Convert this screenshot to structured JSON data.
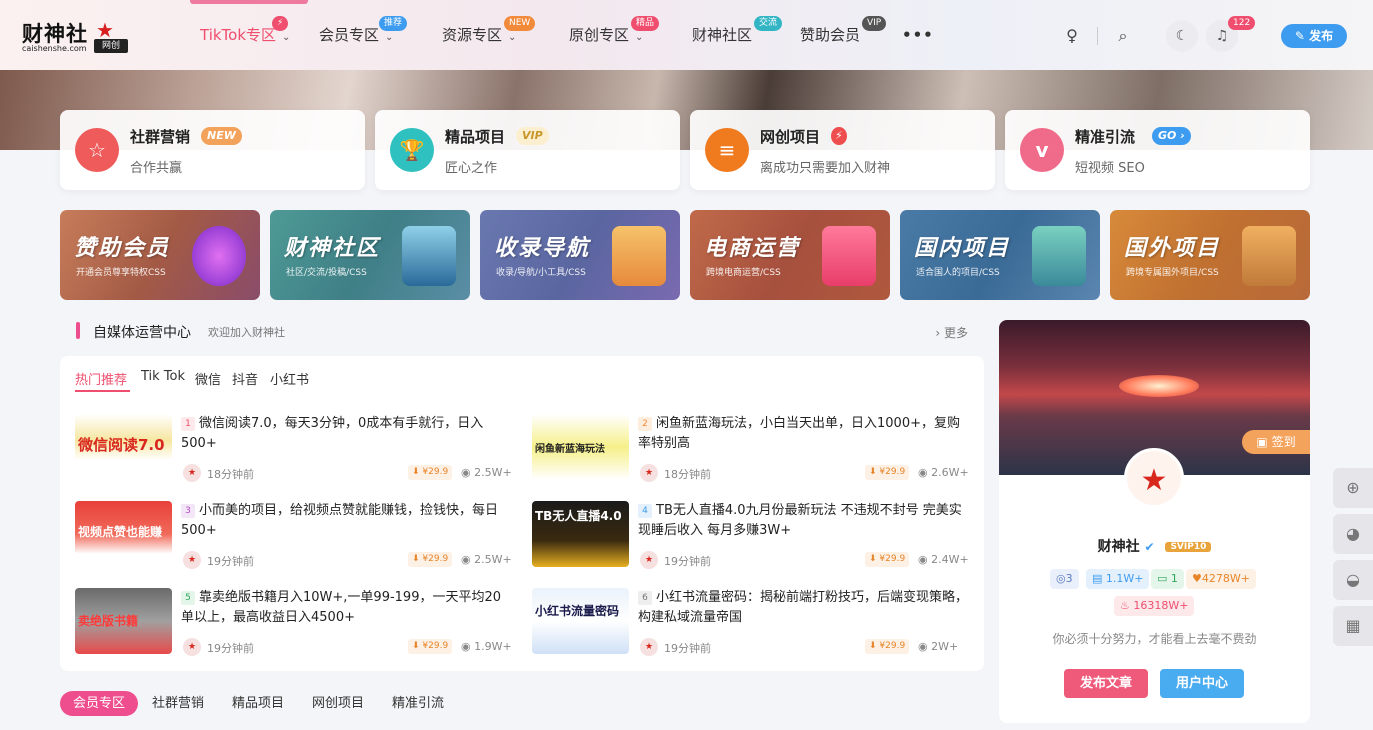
{
  "brand": {
    "name": "财神社",
    "domain": "caishenshe.com",
    "tag": "网创"
  },
  "nav": {
    "items": [
      {
        "label": "TikTok专区",
        "badge": "⚡",
        "badge_color": "#ef4e6e"
      },
      {
        "label": "会员专区",
        "badge": "推荐",
        "badge_color": "#3e9cf0"
      },
      {
        "label": "资源专区",
        "badge": "NEW",
        "badge_color": "#f28a3c"
      },
      {
        "label": "原创专区",
        "badge": "精品",
        "badge_color": "#ef4e6e"
      },
      {
        "label": "财神社区",
        "badge": "交流",
        "badge_color": "#34b5c4"
      },
      {
        "label": "赞助会员",
        "badge": "VIP",
        "badge_color": "#555"
      }
    ],
    "more": "•••",
    "notif_count": "122",
    "publish": "✎ 发布"
  },
  "cards": [
    {
      "title": "社群营销",
      "badge": "NEW",
      "desc": "合作共赢",
      "icon": "☆",
      "color": "#ef5a5a"
    },
    {
      "title": "精品项目",
      "badge": "VIP",
      "desc": "匠心之作",
      "icon": "🏆",
      "color": "#2fc0c0"
    },
    {
      "title": "网创项目",
      "badge": "⚡",
      "desc": "离成功只需要加入财神",
      "icon": "≡",
      "color": "#f07a1e"
    },
    {
      "title": "精准引流",
      "badge": "GO ›",
      "desc": "短视频 SEO",
      "icon": "v",
      "color": "#f06a8a"
    }
  ],
  "banners": [
    {
      "title": "赞助会员",
      "sub": "开通会员尊享特权CSS"
    },
    {
      "title": "财神社区",
      "sub": "社区/交流/投稿/CSS"
    },
    {
      "title": "收录导航",
      "sub": "收录/导航/小工具/CSS"
    },
    {
      "title": "电商运营",
      "sub": "跨境电商运营/CSS"
    },
    {
      "title": "国内项目",
      "sub": "适合国人的项目/CSS"
    },
    {
      "title": "国外项目",
      "sub": "跨境专属国外项目/CSS"
    }
  ],
  "section": {
    "title": "自媒体运营中心",
    "subtitle": "欢迎加入财神社",
    "more": "› 更多"
  },
  "tabs": [
    "热门推荐",
    "Tik Tok",
    "微信",
    "抖音",
    "小红书"
  ],
  "posts": [
    {
      "num": "1",
      "title": "微信阅读7.0，每天3分钟，0成本有手就行，日入500+",
      "time": "18分钟前",
      "price": "¥29.9",
      "views": "2.5W+",
      "thumb": "微信阅读7.0"
    },
    {
      "num": "2",
      "title": "闲鱼新蓝海玩法，小白当天出单，日入1000+，复购率特别高",
      "time": "18分钟前",
      "price": "¥29.9",
      "views": "2.6W+",
      "thumb": "闲鱼新蓝海玩法"
    },
    {
      "num": "3",
      "title": "小而美的项目，给视频点赞就能赚钱，捡钱快，每日500+",
      "time": "19分钟前",
      "price": "¥29.9",
      "views": "2.5W+",
      "thumb": "视频点赞也能赚"
    },
    {
      "num": "4",
      "title": "TB无人直播4.0九月份最新玩法 不违规不封号 完美实现睡后收入 每月多赚3W+",
      "time": "19分钟前",
      "price": "¥29.9",
      "views": "2.4W+",
      "thumb": "TB无人直播4.0"
    },
    {
      "num": "5",
      "title": "靠卖绝版书籍月入10W+,一单99-199，一天平均20单以上，最高收益日入4500+",
      "time": "19分钟前",
      "price": "¥29.9",
      "views": "1.9W+",
      "thumb": "卖绝版书籍"
    },
    {
      "num": "6",
      "title": "小红书流量密码：揭秘前端打粉技巧，后端变现策略，构建私域流量帝国",
      "time": "19分钟前",
      "price": "¥29.9",
      "views": "2W+",
      "thumb": "小红书流量密码"
    }
  ],
  "sidebar": {
    "signin": "签到",
    "name": "财神社",
    "level": "SVIP10",
    "stats": [
      "3",
      "1.1W+",
      "1",
      "4278W+",
      "16318W+"
    ],
    "motto": "你必须十分努力，才能看上去毫不费劲",
    "btn_publish": "发布文章",
    "btn_user": "用户中心"
  },
  "bottom_tabs": [
    "会员专区",
    "社群营销",
    "精品项目",
    "网创项目",
    "精准引流"
  ]
}
